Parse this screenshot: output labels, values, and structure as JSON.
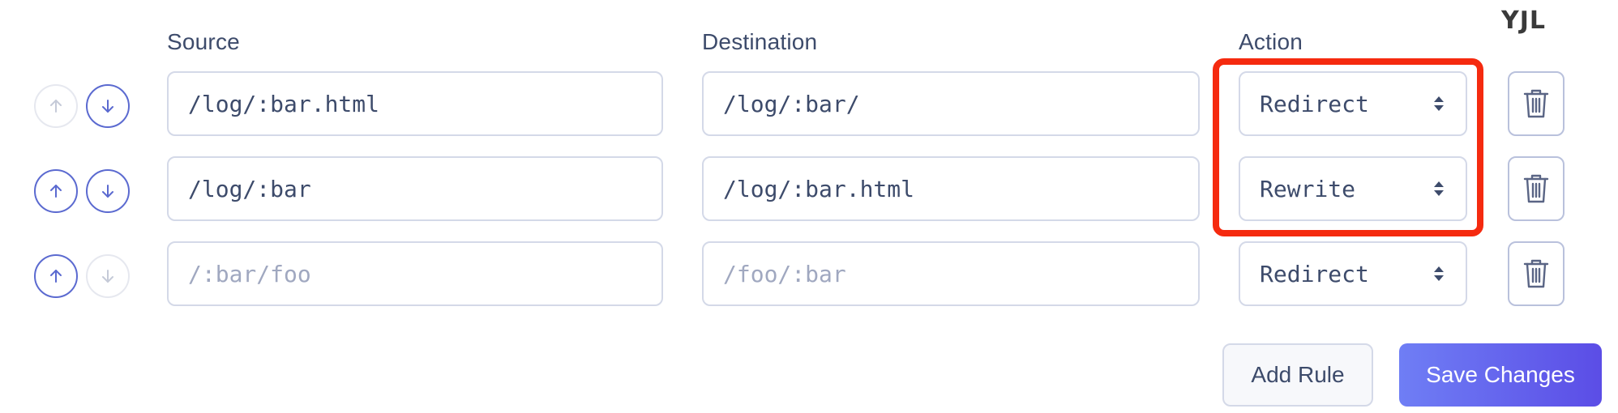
{
  "headers": {
    "source": "Source",
    "destination": "Destination",
    "action": "Action"
  },
  "corner_mark": "YJL",
  "rules": [
    {
      "source": {
        "value": "/log/:bar.html",
        "placeholder": ""
      },
      "destination": {
        "value": "/log/:bar/",
        "placeholder": ""
      },
      "action": "Redirect",
      "move_up_enabled": false,
      "move_down_enabled": true
    },
    {
      "source": {
        "value": "/log/:bar",
        "placeholder": ""
      },
      "destination": {
        "value": "/log/:bar.html",
        "placeholder": ""
      },
      "action": "Rewrite",
      "move_up_enabled": true,
      "move_down_enabled": true
    },
    {
      "source": {
        "value": "",
        "placeholder": "/:bar/foo"
      },
      "destination": {
        "value": "",
        "placeholder": "/foo/:bar"
      },
      "action": "Redirect",
      "move_up_enabled": true,
      "move_down_enabled": false
    }
  ],
  "buttons": {
    "add_rule": "Add Rule",
    "save_changes": "Save Changes"
  },
  "icons": {
    "move_up": "arrow-up-icon",
    "move_down": "arrow-down-icon",
    "action_caret": "select-caret-icon",
    "delete": "trash-icon"
  },
  "colors": {
    "accent": "#5b6ad0",
    "disabled_border": "#e6e8ef",
    "text": "#3d4b6b",
    "placeholder": "#a0a8c0",
    "highlight": "#f52a0f",
    "primary_gradient_start": "#6f7ef5",
    "primary_gradient_end": "#5b4de6"
  }
}
